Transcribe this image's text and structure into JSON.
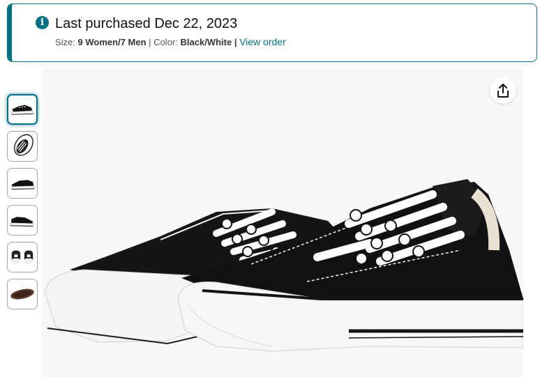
{
  "banner": {
    "title": "Last purchased Dec 22, 2023",
    "size_label": "Size:",
    "size_value": "9 Women/7 Men",
    "separator": "|",
    "color_label": "Color:",
    "color_value": "Black/White",
    "view_order_link": "View order",
    "accent_color": "#007185"
  },
  "gallery": {
    "thumbnails": [
      {
        "view": "side-pair",
        "selected": true
      },
      {
        "view": "top-down",
        "selected": false
      },
      {
        "view": "side-right",
        "selected": false
      },
      {
        "view": "side-left",
        "selected": false
      },
      {
        "view": "back-pair",
        "selected": false
      },
      {
        "view": "sole",
        "selected": false
      }
    ],
    "share_icon": "share-icon"
  }
}
